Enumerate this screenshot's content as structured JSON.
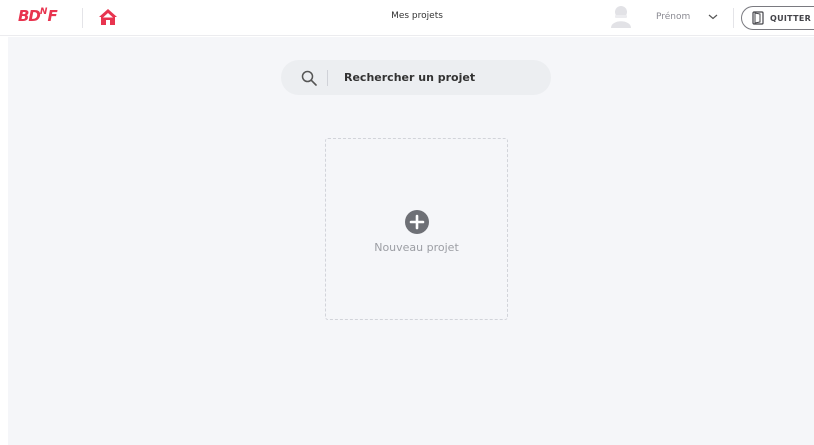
{
  "header": {
    "logo_text": "BDnF",
    "title": "Mes projets",
    "username": "Prénom",
    "quit_label": "QUITTER"
  },
  "search": {
    "placeholder": "Rechercher un projet"
  },
  "projects": {
    "new_project_label": "Nouveau projet"
  },
  "colors": {
    "brand": "#e8344f",
    "background": "#f5f6f9"
  }
}
